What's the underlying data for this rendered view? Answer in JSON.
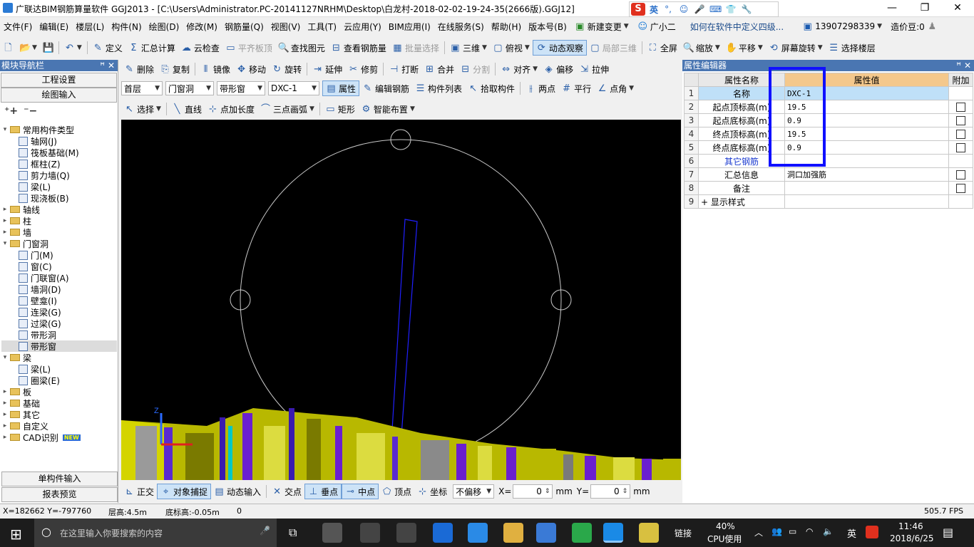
{
  "app": {
    "title": "广联达BIM钢筋算量软件 GGJ2013 - [C:\\Users\\Administrator.PC-20141127NRHM\\Desktop\\白龙村-2018-02-02-19-24-35(2666版).GGJ12]"
  },
  "ime": {
    "s": "S",
    "lang": "英"
  },
  "menu": [
    "文件(F)",
    "编辑(E)",
    "楼层(L)",
    "构件(N)",
    "绘图(D)",
    "修改(M)",
    "钢筋量(Q)",
    "视图(V)",
    "工具(T)",
    "云应用(Y)",
    "BIM应用(I)",
    "在线服务(S)",
    "帮助(H)",
    "版本号(B)"
  ],
  "menu_right": {
    "new_change": "新建变更",
    "xiaoer": "广小二",
    "howto": "如何在软件中定义四级...",
    "phone": "13907298339",
    "beans": "造价豆:0"
  },
  "toolbar1": [
    "定义",
    "汇总计算",
    "云检查",
    "平齐板顶",
    "查找图元",
    "查看钢筋量",
    "批量选择",
    "三维",
    "俯视",
    "动态观察",
    "局部三维",
    "全屏",
    "缩放",
    "平移",
    "屏幕旋转",
    "选择楼层"
  ],
  "toolbar2": [
    "删除",
    "复制",
    "镜像",
    "移动",
    "旋转",
    "延伸",
    "修剪",
    "打断",
    "合并",
    "分割",
    "对齐",
    "偏移",
    "拉伸"
  ],
  "toolbar3": {
    "floor": "首层",
    "category": "门窗洞",
    "type": "带形窗",
    "item": "DXC-1",
    "buttons": [
      "属性",
      "编辑钢筋",
      "构件列表",
      "拾取构件",
      "两点",
      "平行",
      "点角"
    ]
  },
  "toolbar4": [
    "选择",
    "直线",
    "点加长度",
    "三点画弧",
    "矩形",
    "智能布置"
  ],
  "left": {
    "title": "模块导航栏",
    "btn1": "工程设置",
    "btn2": "绘图输入",
    "bottom1": "单构件输入",
    "bottom2": "报表预览"
  },
  "tree": [
    {
      "lvl": 0,
      "tw": "v",
      "icon": "folder",
      "label": "常用构件类型"
    },
    {
      "lvl": 1,
      "icon": "c",
      "label": "轴网(J)"
    },
    {
      "lvl": 1,
      "icon": "c",
      "label": "筏板基础(M)"
    },
    {
      "lvl": 1,
      "icon": "c",
      "label": "框柱(Z)"
    },
    {
      "lvl": 1,
      "icon": "c",
      "label": "剪力墙(Q)"
    },
    {
      "lvl": 1,
      "icon": "c",
      "label": "梁(L)"
    },
    {
      "lvl": 1,
      "icon": "c",
      "label": "现浇板(B)"
    },
    {
      "lvl": 0,
      "tw": ">",
      "icon": "folder",
      "label": "轴线"
    },
    {
      "lvl": 0,
      "tw": ">",
      "icon": "folder",
      "label": "柱"
    },
    {
      "lvl": 0,
      "tw": ">",
      "icon": "folder",
      "label": "墙"
    },
    {
      "lvl": 0,
      "tw": "v",
      "icon": "folder",
      "label": "门窗洞"
    },
    {
      "lvl": 1,
      "icon": "c",
      "label": "门(M)"
    },
    {
      "lvl": 1,
      "icon": "c",
      "label": "窗(C)"
    },
    {
      "lvl": 1,
      "icon": "c",
      "label": "门联窗(A)"
    },
    {
      "lvl": 1,
      "icon": "c",
      "label": "墙洞(D)"
    },
    {
      "lvl": 1,
      "icon": "c",
      "label": "壁龛(I)"
    },
    {
      "lvl": 1,
      "icon": "c",
      "label": "连梁(G)"
    },
    {
      "lvl": 1,
      "icon": "c",
      "label": "过梁(G)"
    },
    {
      "lvl": 1,
      "icon": "c",
      "label": "带形洞"
    },
    {
      "lvl": 1,
      "icon": "c",
      "label": "带形窗",
      "selected": true
    },
    {
      "lvl": 0,
      "tw": "v",
      "icon": "folder",
      "label": "梁"
    },
    {
      "lvl": 1,
      "icon": "c",
      "label": "梁(L)"
    },
    {
      "lvl": 1,
      "icon": "c",
      "label": "圈梁(E)"
    },
    {
      "lvl": 0,
      "tw": ">",
      "icon": "folder",
      "label": "板"
    },
    {
      "lvl": 0,
      "tw": ">",
      "icon": "folder",
      "label": "基础"
    },
    {
      "lvl": 0,
      "tw": ">",
      "icon": "folder",
      "label": "其它"
    },
    {
      "lvl": 0,
      "tw": ">",
      "icon": "folder",
      "label": "自定义"
    },
    {
      "lvl": 0,
      "tw": ">",
      "icon": "folder",
      "label": "CAD识别",
      "badge": "NEW"
    }
  ],
  "props": {
    "title": "属性编辑器",
    "col_name": "属性名称",
    "col_value": "属性值",
    "col_add": "附加",
    "rows": [
      {
        "n": "1",
        "name": "名称",
        "value": "DXC-1",
        "cb": false,
        "sel": true
      },
      {
        "n": "2",
        "name": "起点顶标高(m)",
        "value": "19.5",
        "cb": true
      },
      {
        "n": "3",
        "name": "起点底标高(m)",
        "value": "0.9",
        "cb": true
      },
      {
        "n": "4",
        "name": "终点顶标高(m)",
        "value": "19.5",
        "cb": true
      },
      {
        "n": "5",
        "name": "终点底标高(m)",
        "value": "0.9",
        "cb": true
      },
      {
        "n": "6",
        "name": "其它钢筋",
        "value": "",
        "cb": false,
        "blue": true
      },
      {
        "n": "7",
        "name": "汇总信息",
        "value": "洞口加强筋",
        "cb": true
      },
      {
        "n": "8",
        "name": "备注",
        "value": "",
        "cb": true
      },
      {
        "n": "9",
        "name": "+ 显示样式",
        "value": "",
        "cb": false
      }
    ]
  },
  "snapbar": {
    "items": [
      "正交",
      "对象捕捉",
      "动态输入",
      "交点",
      "垂点",
      "中点",
      "顶点",
      "坐标"
    ],
    "offset": "不偏移",
    "x_label": "X=",
    "x_val": "0",
    "y_label": "Y=",
    "y_val": "0",
    "unit": "mm"
  },
  "status": {
    "coords": "X=182662 Y=-797760",
    "floor_h": "层高:4.5m",
    "base_h": "底标高:-0.05m",
    "val": "0",
    "fps": "505.7 FPS"
  },
  "taskbar": {
    "search": "在这里输入你要搜索的内容",
    "link": "链接",
    "cpu": "40%",
    "cpu_label": "CPU使用",
    "lang": "英",
    "time": "11:46",
    "date": "2018/6/25"
  },
  "colors": {
    "accent": "#4a76b2",
    "highlight_box": "#1010ff",
    "model_yellow": "#c8c800",
    "model_purple": "#6a1fd0"
  }
}
